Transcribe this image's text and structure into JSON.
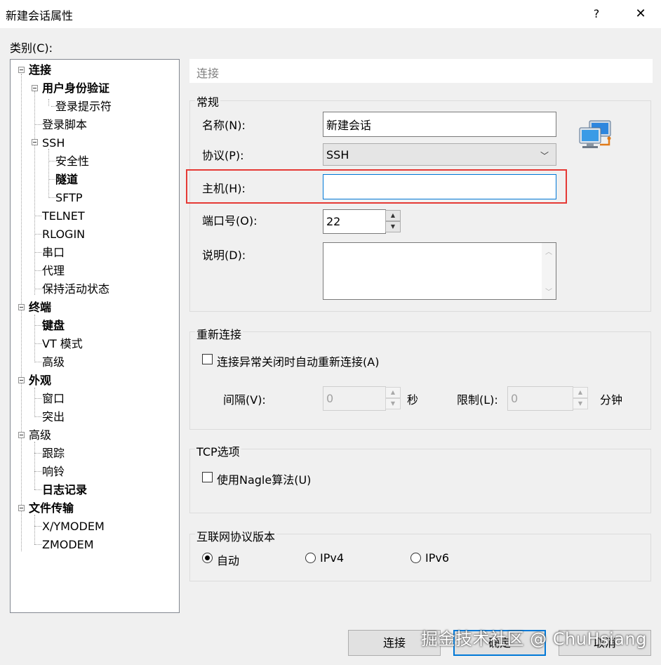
{
  "window": {
    "title": "新建会话属性",
    "help_label": "?",
    "close_label": "✕"
  },
  "category_label": "类别(C):",
  "tree": [
    {
      "label": "连接",
      "bold": true
    },
    {
      "label": "用户身份验证",
      "bold": true
    },
    {
      "label": "登录提示符",
      "bold": false
    },
    {
      "label": "登录脚本",
      "bold": false
    },
    {
      "label": "SSH",
      "bold": false
    },
    {
      "label": "安全性",
      "bold": false
    },
    {
      "label": "隧道",
      "bold": true
    },
    {
      "label": "SFTP",
      "bold": false
    },
    {
      "label": "TELNET",
      "bold": false
    },
    {
      "label": "RLOGIN",
      "bold": false
    },
    {
      "label": "串口",
      "bold": false
    },
    {
      "label": "代理",
      "bold": false
    },
    {
      "label": "保持活动状态",
      "bold": false
    },
    {
      "label": "终端",
      "bold": true
    },
    {
      "label": "键盘",
      "bold": true
    },
    {
      "label": "VT 模式",
      "bold": false
    },
    {
      "label": "高级",
      "bold": false
    },
    {
      "label": "外观",
      "bold": true
    },
    {
      "label": "窗口",
      "bold": false
    },
    {
      "label": "突出",
      "bold": false
    },
    {
      "label": "高级",
      "bold": false
    },
    {
      "label": "跟踪",
      "bold": false
    },
    {
      "label": "响铃",
      "bold": false
    },
    {
      "label": "日志记录",
      "bold": true
    },
    {
      "label": "文件传输",
      "bold": true
    },
    {
      "label": "X/YMODEM",
      "bold": false
    },
    {
      "label": "ZMODEM",
      "bold": false
    }
  ],
  "header": "连接",
  "general": {
    "legend": "常规",
    "name_label": "名称(N):",
    "name_value": "新建会话",
    "protocol_label": "协议(P):",
    "protocol_value": "SSH",
    "host_label": "主机(H):",
    "host_value": "",
    "port_label": "端口号(O):",
    "port_value": "22",
    "desc_label": "说明(D):",
    "desc_value": "",
    "computer_icon": "network-computers-icon"
  },
  "reconnect": {
    "legend": "重新连接",
    "checkbox_label": "连接异常关闭时自动重新连接(A)",
    "interval_label": "间隔(V):",
    "interval_value": "0",
    "interval_unit": "秒",
    "limit_label": "限制(L):",
    "limit_value": "0",
    "limit_unit": "分钟"
  },
  "tcp": {
    "legend": "TCP选项",
    "nagle_label": "使用Nagle算法(U)"
  },
  "ipver": {
    "legend": "互联网协议版本",
    "options": [
      {
        "label": "自动",
        "selected": true
      },
      {
        "label": "IPv4",
        "selected": false
      },
      {
        "label": "IPv6",
        "selected": false
      }
    ]
  },
  "buttons": {
    "connect": "连接",
    "ok": "确定",
    "cancel": "取消"
  },
  "watermark": "掘金技术社区 @ ChuHsiang",
  "colors": {
    "highlight": "#e53935",
    "focus": "#0078d7"
  }
}
